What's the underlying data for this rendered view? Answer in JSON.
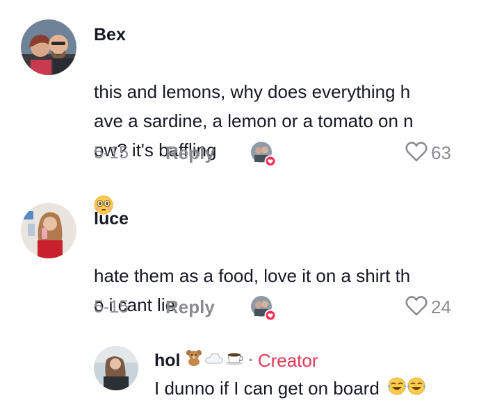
{
  "comments": [
    {
      "username": "Bex",
      "text": "this and lemons, why does everything h\nave a sardine, a lemon or a tomato on n\now? it's baffling",
      "text_emoji": "flushed-face",
      "date": "5-15",
      "reply_label": "Reply",
      "like_count": "63"
    },
    {
      "username": "luce",
      "text": "hate them as a food, love it on a shirt th\no i cant lie",
      "date": "5-15",
      "reply_label": "Reply",
      "like_count": "24"
    }
  ],
  "reply": {
    "username": "hol",
    "name_emojis": [
      "teddy-bear",
      "cloud",
      "coffee"
    ],
    "separator": "·",
    "creator_label": "Creator",
    "text": "I dunno if I can get on board",
    "text_emojis": [
      "tears-of-joy",
      "tears-of-joy"
    ]
  },
  "colors": {
    "text": "#161823",
    "secondary": "#8a8b91",
    "creator": "#e0395a",
    "liked_badge": "#fe2c55"
  }
}
